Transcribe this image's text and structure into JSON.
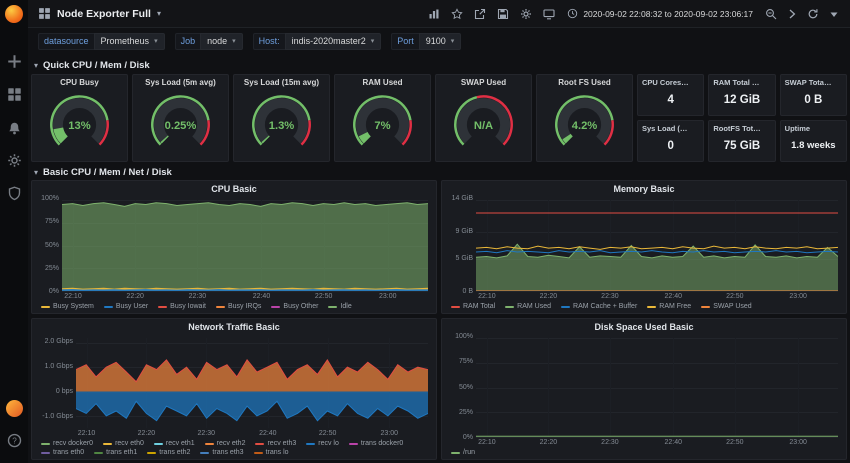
{
  "app": {
    "accent_orange": "#F46800",
    "green": "#73BF69",
    "red": "#E02F44"
  },
  "sidebar": {
    "logo": "grafana-logo",
    "top_icons": [
      {
        "name": "plus-icon"
      },
      {
        "name": "dashboards-grid-icon"
      },
      {
        "name": "alerting-bell-icon"
      },
      {
        "name": "configuration-gear-icon"
      },
      {
        "name": "security-shield-icon"
      }
    ],
    "bottom_icons": [
      {
        "name": "user-avatar"
      },
      {
        "name": "help-icon"
      }
    ]
  },
  "header": {
    "title": "Node Exporter Full",
    "icons": [
      {
        "name": "add-panel-icon"
      },
      {
        "name": "star-icon"
      },
      {
        "name": "share-icon"
      },
      {
        "name": "save-icon"
      },
      {
        "name": "settings-gear-icon"
      },
      {
        "name": "tv-icon"
      }
    ],
    "time_range": "2020-09-02 22:08:32 to 2020-09-02 23:06:17",
    "time_controls": [
      {
        "name": "zoom-out-icon"
      },
      {
        "name": "chevron-right-icon"
      },
      {
        "name": "refresh-icon"
      },
      {
        "name": "caret-down-icon"
      }
    ]
  },
  "variables": [
    {
      "label": "datasource",
      "value": "Prometheus"
    },
    {
      "label": "Job",
      "value": "node"
    },
    {
      "label": "Host:",
      "value": "indis-2020master2"
    },
    {
      "label": "Port",
      "value": "9100"
    }
  ],
  "rows": [
    {
      "title": "Quick CPU / Mem / Disk"
    },
    {
      "title": "Basic CPU / Mem / Net / Disk"
    }
  ],
  "gauges": [
    {
      "title": "CPU Busy",
      "value": "13%",
      "fraction": 0.13,
      "red_from": 0.8
    },
    {
      "title": "Sys Load (5m avg)",
      "value": "0.25%",
      "fraction": 0.0025,
      "red_from": 0.8
    },
    {
      "title": "Sys Load (15m avg)",
      "value": "1.3%",
      "fraction": 0.013,
      "red_from": 0.8
    },
    {
      "title": "RAM Used",
      "value": "7%",
      "fraction": 0.07,
      "red_from": 0.8
    },
    {
      "title": "SWAP Used",
      "value": "N/A",
      "fraction": 0,
      "red_from": 0.45
    },
    {
      "title": "Root FS Used",
      "value": "4.2%",
      "fraction": 0.042,
      "red_from": 0.8
    }
  ],
  "stats": [
    {
      "title": "CPU Cores…",
      "value": "4"
    },
    {
      "title": "RAM Total …",
      "value": "12 GiB"
    },
    {
      "title": "SWAP Tota…",
      "value": "0 B"
    },
    {
      "title": "Sys Load (…",
      "value": "0"
    },
    {
      "title": "RootFS Tot…",
      "value": "75 GiB"
    },
    {
      "title": "Uptime",
      "value": "1.8 weeks"
    }
  ],
  "chart_data": [
    {
      "key": "cpu-basic",
      "row": 1,
      "type": "area",
      "title": "CPU Basic",
      "ylim": [
        0,
        100
      ],
      "ylabel_w": 26,
      "yticks": [
        {
          "v": 100,
          "label": "100%"
        },
        {
          "v": 75,
          "label": "75%"
        },
        {
          "v": 50,
          "label": "50%"
        },
        {
          "v": 25,
          "label": "25%"
        },
        {
          "v": 0,
          "label": "0%"
        }
      ],
      "xticks": [
        {
          "x": 0.03,
          "label": "22:10"
        },
        {
          "x": 0.2,
          "label": "22:20"
        },
        {
          "x": 0.37,
          "label": "22:30"
        },
        {
          "x": 0.545,
          "label": "22:40"
        },
        {
          "x": 0.715,
          "label": "22:50"
        },
        {
          "x": 0.89,
          "label": "23:00"
        }
      ],
      "legend": [
        {
          "label": "Busy System",
          "color": "#EAB839"
        },
        {
          "label": "Busy User",
          "color": "#1F78C1"
        },
        {
          "label": "Busy Iowait",
          "color": "#E24D42"
        },
        {
          "label": "Busy IRQs",
          "color": "#EF843C"
        },
        {
          "label": "Busy Other",
          "color": "#BA43A9"
        },
        {
          "label": "Idle",
          "color": "#7EB26D"
        }
      ],
      "series": [
        {
          "name": "Idle",
          "color": "#7EB26D",
          "kind": "area",
          "opacity": 0.55,
          "values": [
            95,
            96,
            94,
            96,
            97,
            95,
            93,
            96,
            95,
            97,
            96,
            94,
            95,
            96,
            97,
            95,
            94,
            96,
            95,
            93,
            96,
            95,
            97,
            96,
            94,
            96,
            95,
            97,
            95,
            96,
            94,
            95,
            96,
            97,
            95,
            96
          ]
        },
        {
          "name": "Busy System",
          "color": "#EAB839",
          "kind": "area",
          "opacity": 0.9,
          "values": [
            2.5,
            3,
            2,
            2.5,
            3,
            2,
            3,
            2.5,
            2,
            3,
            2.5,
            2,
            2.5,
            3,
            2,
            2.5,
            3,
            2,
            2.5,
            3,
            2,
            2.5,
            3,
            2.5,
            2,
            3,
            2.5,
            2,
            3,
            2.5,
            2,
            2.5,
            3,
            2,
            2.5,
            3
          ]
        },
        {
          "name": "Busy User",
          "color": "#1F78C1",
          "kind": "area",
          "opacity": 0.9,
          "values": [
            1.2,
            1.5,
            1,
            1.3,
            1.1,
            1.4,
            1,
            1.2,
            1.5,
            1.1,
            1.3,
            1,
            1.4,
            1.2,
            1.1,
            1.5,
            1,
            1.3,
            1.2,
            1.4,
            1,
            1.2,
            1.3,
            1.1,
            1.5,
            1,
            1.2,
            1.4,
            1.1,
            1.3,
            1,
            1.2,
            1.5,
            1.1,
            1.3,
            1.2
          ]
        }
      ]
    },
    {
      "key": "memory-basic",
      "row": 1,
      "type": "area",
      "title": "Memory Basic",
      "ylim": [
        0,
        14
      ],
      "ylabel_w": 30,
      "yticks": [
        {
          "v": 14,
          "label": "14 GiB"
        },
        {
          "v": 9,
          "label": "9 GiB"
        },
        {
          "v": 5,
          "label": "5 GiB"
        },
        {
          "v": 0,
          "label": "0 B"
        }
      ],
      "xticks": [
        {
          "x": 0.03,
          "label": "22:10"
        },
        {
          "x": 0.2,
          "label": "22:20"
        },
        {
          "x": 0.37,
          "label": "22:30"
        },
        {
          "x": 0.545,
          "label": "22:40"
        },
        {
          "x": 0.715,
          "label": "22:50"
        },
        {
          "x": 0.89,
          "label": "23:00"
        }
      ],
      "legend": [
        {
          "label": "RAM Total",
          "color": "#E24D42"
        },
        {
          "label": "RAM Used",
          "color": "#7EB26D"
        },
        {
          "label": "RAM Cache + Buffer",
          "color": "#1F78C1"
        },
        {
          "label": "RAM Free",
          "color": "#EAB839"
        },
        {
          "label": "SWAP Used",
          "color": "#EF843C"
        }
      ],
      "series": [
        {
          "name": "RAM Used",
          "color": "#7EB26D",
          "kind": "area",
          "opacity": 0.5,
          "values": [
            5.2,
            5.3,
            5.1,
            5.4,
            7.2,
            5.3,
            5.2,
            5.5,
            5.3,
            5.1,
            6.8,
            5.2,
            5.4,
            5.3,
            5.2,
            7.0,
            5.3,
            5.1,
            5.4,
            5.2,
            5.3,
            6.9,
            5.2,
            5.4,
            5.1,
            5.3,
            5.2,
            7.1,
            5.3,
            5.2,
            5.4,
            5.1,
            5.3,
            5.2,
            6.7,
            5.3
          ]
        },
        {
          "name": "RAM Cache + Buffer",
          "color": "#1F78C1",
          "kind": "line",
          "values": [
            6.0,
            6.1,
            5.9,
            6.2,
            6.0,
            6.1,
            6.0,
            5.9,
            6.2,
            6.0,
            6.1,
            6.0,
            6.2,
            5.9,
            6.0,
            6.1,
            6.0,
            6.2,
            6.0,
            5.9,
            6.1,
            6.0,
            6.2,
            6.0,
            6.1,
            5.9,
            6.0,
            6.1,
            6.0,
            6.2,
            6.0,
            6.1,
            5.9,
            6.0,
            6.1,
            6.0
          ]
        },
        {
          "name": "RAM Free",
          "color": "#EAB839",
          "kind": "line",
          "values": [
            6.6,
            6.7,
            6.5,
            6.8,
            6.6,
            6.5,
            6.9,
            6.6,
            6.7,
            6.5,
            6.8,
            6.6,
            6.4,
            6.7,
            6.6,
            6.8,
            6.5,
            6.6,
            6.7,
            6.5,
            6.8,
            6.6,
            6.5,
            6.9,
            6.6,
            6.7,
            6.5,
            6.8,
            6.6,
            6.5,
            6.7,
            6.6,
            6.8,
            6.5,
            6.6,
            6.7
          ]
        },
        {
          "name": "SWAP Used",
          "color": "#EF843C",
          "kind": "line",
          "values": [
            0,
            0
          ]
        },
        {
          "name": "RAM Total",
          "color": "#E24D42",
          "kind": "line",
          "values": [
            12,
            12
          ]
        }
      ]
    },
    {
      "key": "network-basic",
      "row": 2,
      "type": "area",
      "title": "Network Traffic Basic",
      "ylim": [
        -1.5,
        2.2
      ],
      "ylabel_w": 40,
      "yticks": [
        {
          "v": 2,
          "label": "2.0 Gbps"
        },
        {
          "v": 1,
          "label": "1.0 Gbps"
        },
        {
          "v": 0,
          "label": "0 bps"
        },
        {
          "v": -1,
          "label": "-1.0 Gbps"
        }
      ],
      "xticks": [
        {
          "x": 0.03,
          "label": "22:10"
        },
        {
          "x": 0.2,
          "label": "22:20"
        },
        {
          "x": 0.37,
          "label": "22:30"
        },
        {
          "x": 0.545,
          "label": "22:40"
        },
        {
          "x": 0.715,
          "label": "22:50"
        },
        {
          "x": 0.89,
          "label": "23:00"
        }
      ],
      "legend": [
        {
          "label": "recv docker0",
          "color": "#7EB26D"
        },
        {
          "label": "recv eth0",
          "color": "#EAB839"
        },
        {
          "label": "recv eth1",
          "color": "#6ED0E0"
        },
        {
          "label": "recv eth2",
          "color": "#EF843C"
        },
        {
          "label": "recv eth3",
          "color": "#E24D42"
        },
        {
          "label": "recv lo",
          "color": "#1F78C1"
        },
        {
          "label": "trans docker0",
          "color": "#BA43A9"
        },
        {
          "label": "trans eth0",
          "color": "#705DA0"
        },
        {
          "label": "trans eth1",
          "color": "#508642"
        },
        {
          "label": "trans eth2",
          "color": "#CCA300"
        },
        {
          "label": "trans eth3",
          "color": "#447EBC"
        },
        {
          "label": "trans lo",
          "color": "#C15C17"
        }
      ],
      "series": [
        {
          "name": "recv",
          "color": "#EF843C",
          "stroke": "#E24D42",
          "kind": "area",
          "opacity": 0.72,
          "values": [
            0.9,
            1.1,
            0.6,
            1.0,
            1.2,
            0.8,
            0.4,
            1.1,
            0.9,
            1.3,
            0.7,
            1.0,
            0.5,
            1.2,
            0.9,
            1.1,
            0.6,
            1.3,
            0.8,
            1.0,
            1.2,
            0.5,
            0.9,
            1.1,
            0.7,
            1.3,
            0.6,
            1.0,
            0.8,
            1.2,
            0.9,
            0.5,
            1.1,
            0.8,
            1.0,
            0.9
          ]
        },
        {
          "name": "trans",
          "color": "#1F78C1",
          "stroke": "#1F78C1",
          "kind": "area",
          "opacity": 0.72,
          "values": [
            -0.7,
            -0.9,
            -0.5,
            -1.0,
            -0.8,
            -1.1,
            -0.4,
            -0.9,
            -1.2,
            -0.6,
            -0.8,
            -1.0,
            -0.5,
            -1.1,
            -0.7,
            -0.9,
            -1.2,
            -0.6,
            -1.0,
            -0.8,
            -0.4,
            -1.1,
            -0.9,
            -0.6,
            -1.2,
            -0.8,
            -1.0,
            -0.5,
            -0.9,
            -1.1,
            -0.7,
            -1.0,
            -0.6,
            -0.8,
            -1.1,
            -0.9
          ]
        }
      ]
    },
    {
      "key": "disk-basic",
      "row": 2,
      "type": "line",
      "title": "Disk Space Used Basic",
      "ylim": [
        0,
        100
      ],
      "ylabel_w": 30,
      "yticks": [
        {
          "v": 100,
          "label": "100%"
        },
        {
          "v": 75,
          "label": "75%"
        },
        {
          "v": 50,
          "label": "50%"
        },
        {
          "v": 25,
          "label": "25%"
        },
        {
          "v": 0,
          "label": "0%"
        }
      ],
      "xticks": [
        {
          "x": 0.03,
          "label": "22:10"
        },
        {
          "x": 0.2,
          "label": "22:20"
        },
        {
          "x": 0.37,
          "label": "22:30"
        },
        {
          "x": 0.545,
          "label": "22:40"
        },
        {
          "x": 0.715,
          "label": "22:50"
        },
        {
          "x": 0.89,
          "label": "23:00"
        }
      ],
      "legend": [
        {
          "label": "/run",
          "color": "#7EB26D"
        }
      ],
      "series": [
        {
          "name": "/run",
          "color": "#7EB26D",
          "kind": "line",
          "values": [
            0.8,
            0.8
          ]
        }
      ]
    }
  ]
}
